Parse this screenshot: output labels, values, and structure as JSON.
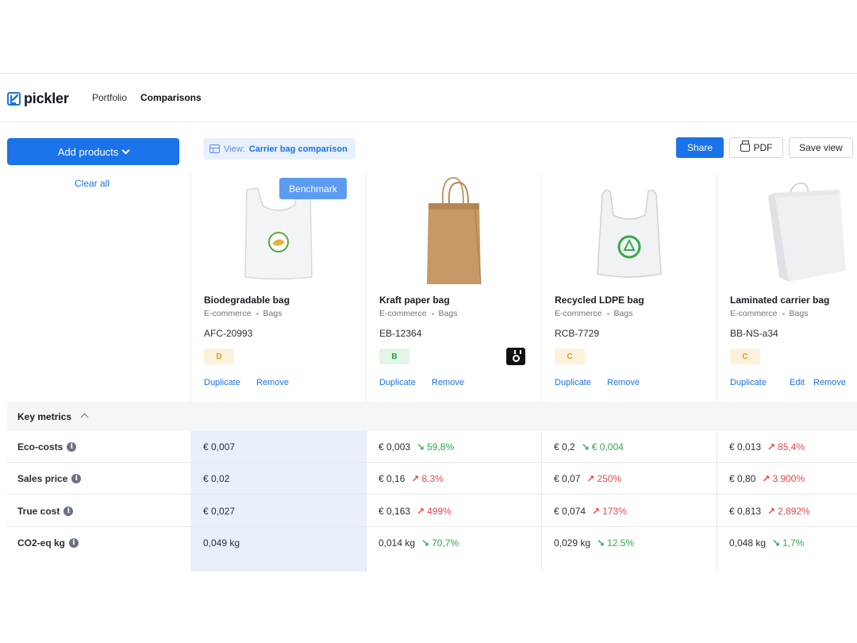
{
  "app": {
    "name": "pickler"
  },
  "nav": {
    "portfolio": "Portfolio",
    "comparisons": "Comparisons"
  },
  "toolbar": {
    "add_products": "Add products",
    "clear_all": "Clear all",
    "view_prefix": "View:",
    "view_name": "Carrier bag comparison",
    "share": "Share",
    "pdf": "PDF",
    "save_view": "Save view"
  },
  "benchmark_label": "Benchmark",
  "colors": {
    "accent": "#1a73e8",
    "good": "#2fa84f",
    "bad": "#e5484d",
    "benchmark_band": "#e9f0fc"
  },
  "products": [
    {
      "name": "Biodegradable bag",
      "channel": "E-commerce",
      "category": "Bags",
      "sku": "AFC-20993",
      "grade": "D",
      "actions": [
        "Duplicate",
        "Remove"
      ],
      "icon": "biodegradable-bag-image"
    },
    {
      "name": "Kraft paper bag",
      "channel": "E-commerce",
      "category": "Bags",
      "sku": "EB-12364",
      "grade": "B",
      "actions": [
        "Duplicate",
        "Remove"
      ],
      "icon": "kraft-paper-bag-image",
      "badge": "medal-icon"
    },
    {
      "name": "Recycled LDPE bag",
      "channel": "E-commerce",
      "category": "Bags",
      "sku": "RCB-7729",
      "grade": "C",
      "actions": [
        "Duplicate",
        "Remove"
      ],
      "icon": "recycled-ldpe-bag-image"
    },
    {
      "name": "Laminated carrier bag",
      "channel": "E-commerce",
      "category": "Bags",
      "sku": "BB-NS-a34",
      "grade": "C",
      "actions": [
        "Duplicate",
        "Edit",
        "Remove"
      ],
      "icon": "laminated-carrier-bag-image"
    }
  ],
  "metrics": {
    "section_title": "Key metrics",
    "rows": [
      {
        "label": "Eco-costs",
        "cells": [
          {
            "value": "€ 0,007"
          },
          {
            "value": "€ 0,003",
            "delta": "59,8%",
            "dir": "down"
          },
          {
            "value": "€ 0,2",
            "delta": "€ 0,004",
            "dir": "down"
          },
          {
            "value": "€ 0,013",
            "delta": "85,4%",
            "dir": "up"
          }
        ]
      },
      {
        "label": "Sales price",
        "cells": [
          {
            "value": "€ 0,02"
          },
          {
            "value": "€ 0,16",
            "delta": "8.3%",
            "dir": "up"
          },
          {
            "value": "€ 0,07",
            "delta": "250%",
            "dir": "up"
          },
          {
            "value": "€ 0,80",
            "delta": "3.900%",
            "dir": "up"
          }
        ]
      },
      {
        "label": "True cost",
        "cells": [
          {
            "value": "€ 0,027"
          },
          {
            "value": "€ 0,163",
            "delta": "499%",
            "dir": "up"
          },
          {
            "value": "€ 0,074",
            "delta": "173%",
            "dir": "up"
          },
          {
            "value": "€ 0,813",
            "delta": "2.892%",
            "dir": "up"
          }
        ]
      },
      {
        "label": "CO2-eq kg",
        "cells": [
          {
            "value": "0,049 kg"
          },
          {
            "value": "0,014 kg",
            "delta": "70,7%",
            "dir": "down"
          },
          {
            "value": "0,029 kg",
            "delta": "12.5%",
            "dir": "down"
          },
          {
            "value": "0,048 kg",
            "delta": "1,7%",
            "dir": "down"
          }
        ]
      }
    ]
  }
}
